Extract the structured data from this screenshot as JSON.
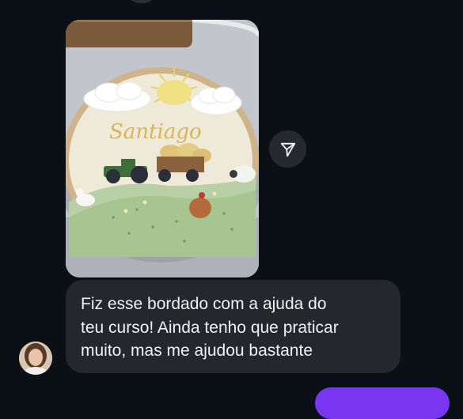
{
  "conversation": {
    "incoming_media": {
      "embroidered_name": "Santiago"
    },
    "incoming_text": {
      "message": "Fiz esse bordado com a ajuda do\nteu curso! Ainda tenho que praticar\nmuito, mas me ajudou bastante"
    },
    "actions": {
      "share_icon": "send-icon"
    }
  },
  "colors": {
    "background": "#0b0f16",
    "incoming_bubble": "#25272c",
    "outgoing_bubble": "#7a35f0",
    "text": "#f1f1f3"
  }
}
